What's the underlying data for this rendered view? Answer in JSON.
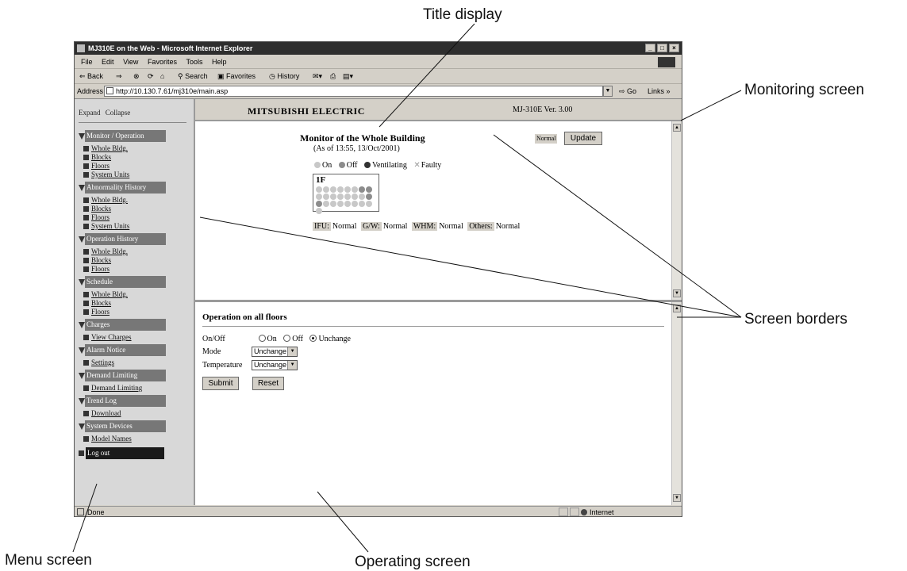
{
  "callouts": {
    "title_display": "Title display",
    "monitoring_screen": "Monitoring screen",
    "screen_borders": "Screen borders",
    "menu_screen": "Menu screen",
    "operating_screen": "Operating screen"
  },
  "browser": {
    "window_title": "MJ310E on the Web - Microsoft Internet Explorer",
    "window_buttons": [
      "_",
      "□",
      "×"
    ],
    "menubar": [
      "File",
      "Edit",
      "View",
      "Favorites",
      "Tools",
      "Help"
    ],
    "toolbar": {
      "back": "⇐ Back",
      "forward": "⇒",
      "search": "Search",
      "favorites": "Favorites",
      "history": "History"
    },
    "address_label": "Address",
    "address_url": "http://10.130.7.61/mj310e/main.asp",
    "go_label": "Go",
    "links_label": "Links »",
    "status_text": "Done",
    "status_zone": "Internet"
  },
  "menu": {
    "expand": "Expand",
    "collapse": "Collapse",
    "groups": [
      {
        "label": "Monitor / Operation",
        "items": [
          "Whole Bldg.",
          "Blocks",
          "Floors",
          "System Units"
        ]
      },
      {
        "label": "Abnormality History",
        "items": [
          "Whole Bldg.",
          "Blocks",
          "Floors",
          "System Units"
        ]
      },
      {
        "label": "Operation History",
        "items": [
          "Whole Bldg.",
          "Blocks",
          "Floors"
        ]
      },
      {
        "label": "Schedule",
        "items": [
          "Whole Bldg.",
          "Blocks",
          "Floors"
        ]
      },
      {
        "label": "Charges",
        "items": [
          "View Charges"
        ]
      },
      {
        "label": "Alarm Notice",
        "items": [
          "Settings"
        ]
      },
      {
        "label": "Demand Limiting",
        "items": [
          "Demand Limiting"
        ]
      },
      {
        "label": "Trend Log",
        "items": [
          "Download"
        ]
      },
      {
        "label": "System Devices",
        "items": [
          "Model Names"
        ]
      }
    ],
    "logout": "Log out"
  },
  "title_frame": {
    "brand": "MITSUBISHI ELECTRIC",
    "version": "MJ-310E Ver. 3.00"
  },
  "monitor": {
    "title": "Monitor of the Whole Building",
    "as_of": "(As of 13:55, 13/Oct/2001)",
    "status_badge": "Normal",
    "update_button": "Update",
    "legend": [
      {
        "label": "On",
        "color": "#c8c8c8"
      },
      {
        "label": "Off",
        "color": "#8c8c8c"
      },
      {
        "label": "Ventilating",
        "color": "#333333"
      },
      {
        "label": "Faulty",
        "color": "#999999"
      }
    ],
    "floor_label": "1F",
    "unit_colors": {
      "on": "#c8c8c8",
      "off": "#8c8c8c"
    },
    "units": [
      "on",
      "on",
      "on",
      "on",
      "on",
      "on",
      "off",
      "off",
      "on",
      "on",
      "on",
      "on",
      "on",
      "on",
      "on",
      "off",
      "off",
      "on",
      "on",
      "on",
      "on",
      "on",
      "on",
      "on",
      "on"
    ],
    "statuses": [
      {
        "label": "IFU:",
        "value": "Normal"
      },
      {
        "label": "G/W:",
        "value": "Normal"
      },
      {
        "label": "WHM:",
        "value": "Normal"
      },
      {
        "label": "Others:",
        "value": "Normal"
      }
    ]
  },
  "operation": {
    "title": "Operation on all floors",
    "onoff_label": "On/Off",
    "onoff_options": [
      "On",
      "Off",
      "Unchange"
    ],
    "onoff_selected": "Unchange",
    "mode_label": "Mode",
    "mode_value": "Unchange",
    "temp_label": "Temperature",
    "temp_value": "Unchange",
    "submit": "Submit",
    "reset": "Reset"
  }
}
